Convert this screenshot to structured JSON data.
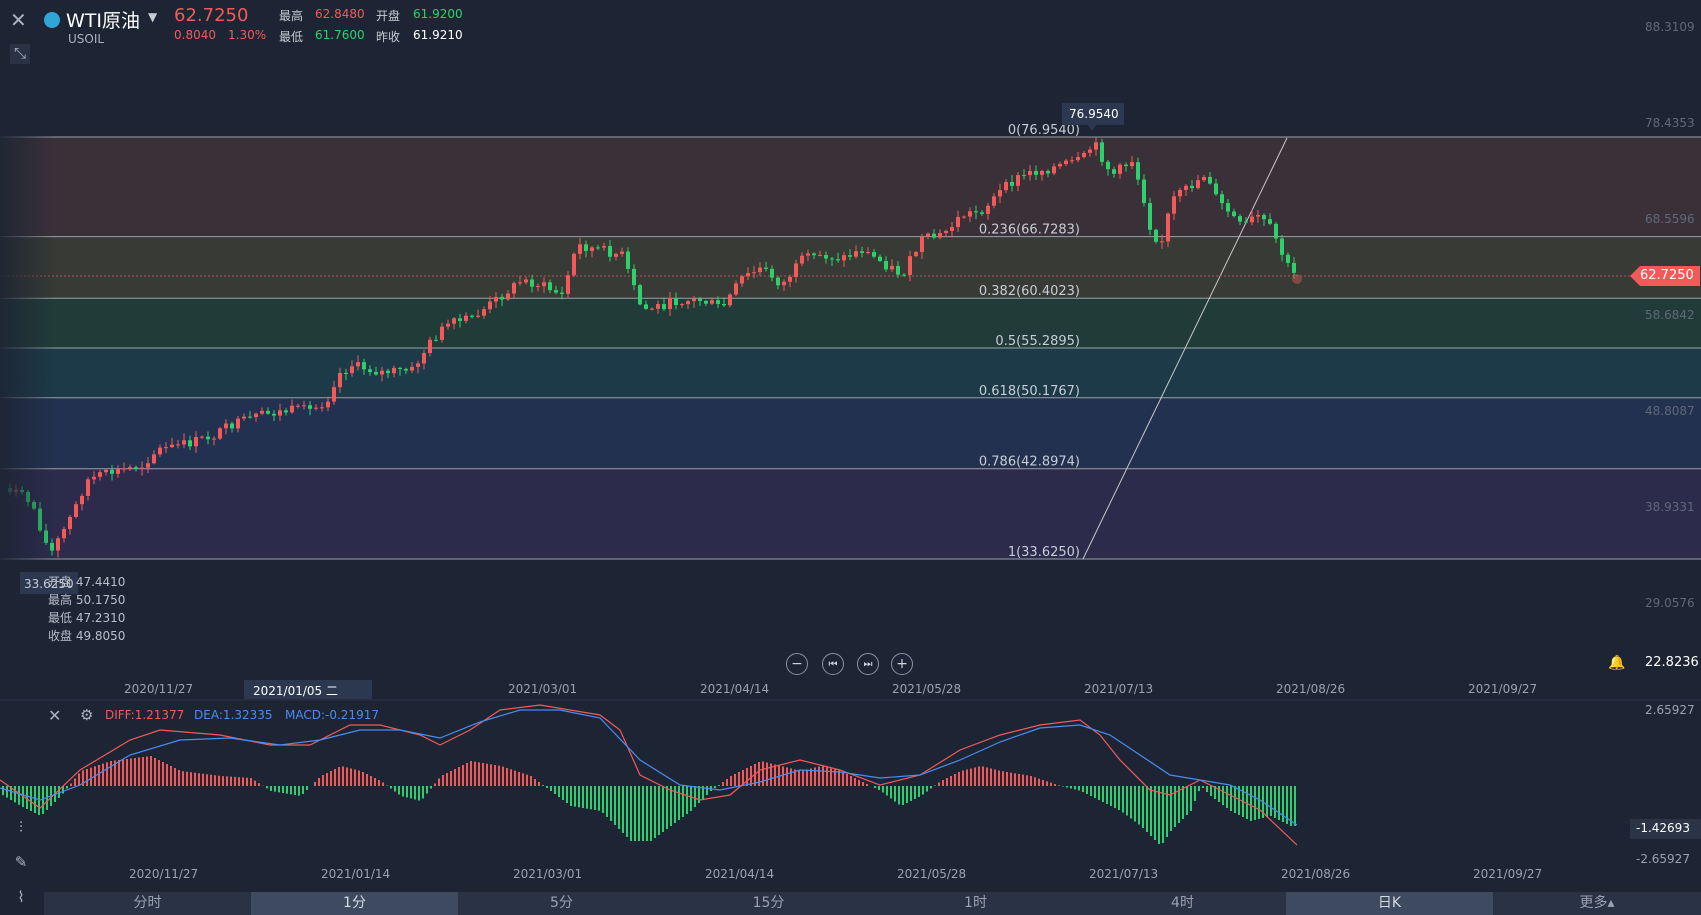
{
  "header": {
    "title": "WTI原油",
    "symbol": "USOIL",
    "price": "62.7250",
    "change": "0.8040",
    "change_pct": "1.30%",
    "high_label": "最高",
    "high": "62.8480",
    "open_label": "开盘",
    "open": "61.9200",
    "low_label": "最低",
    "low": "61.7600",
    "prev_label": "昨收",
    "prev": "61.9210"
  },
  "crosshair": {
    "price_tag": "33.6250",
    "date_tag": "2021/01/05 二",
    "open_line": "开盘 47.4410",
    "high_line": "最高 50.1750",
    "low_line": "最低 47.2310",
    "close_line": "收盘 49.8050"
  },
  "price_axis": [
    "88.3109",
    "78.4353",
    "68.5596",
    "58.6842",
    "48.8087",
    "38.9331",
    "29.0576",
    "22.8236"
  ],
  "current_price_tag": "62.7250",
  "high_tag": "76.9540",
  "date_axis": [
    "2020/11/27",
    "2021/01/14",
    "2021/03/01",
    "2021/04/14",
    "2021/05/28",
    "2021/07/13",
    "2021/08/26",
    "2021/09/27"
  ],
  "fib_levels": [
    {
      "label": "0(76.9540)",
      "value": 76.954
    },
    {
      "label": "0.236(66.7283)",
      "value": 66.7283
    },
    {
      "label": "0.382(60.4023)",
      "value": 60.4023
    },
    {
      "label": "0.5(55.2895)",
      "value": 55.2895
    },
    {
      "label": "0.618(50.1767)",
      "value": 50.1767
    },
    {
      "label": "0.786(42.8974)",
      "value": 42.8974
    },
    {
      "label": "1(33.6250)",
      "value": 33.625
    }
  ],
  "macd": {
    "diff_label": "DIFF:1.21377",
    "dea_label": "DEA:1.32335",
    "macd_label": "MACD:-0.21917",
    "axis": [
      "2.65927",
      "-1.42693",
      "-2.65927"
    ]
  },
  "tabs": [
    "分时",
    "1分",
    "5分",
    "15分",
    "1时",
    "4时",
    "日K",
    "更多▴"
  ],
  "colors": {
    "up": "#f25a5a",
    "down": "#2fd06c",
    "diff": "#f25a5a",
    "dea": "#4a8cf0"
  },
  "chart_data": {
    "type": "candlestick",
    "title": "WTI原油 USOIL 日K",
    "ylim": [
      22.8236,
      88.3109
    ],
    "key_points": [
      {
        "date": "2020/11/02",
        "value": 33.625,
        "label": "low"
      },
      {
        "date": "2021/01/05",
        "open": 47.441,
        "high": 50.175,
        "low": 47.231,
        "close": 49.805
      },
      {
        "date": "2021/03/05",
        "value": 66.5
      },
      {
        "date": "2021/03/24",
        "value": 57.5
      },
      {
        "date": "2021/06/01",
        "value": 68.0
      },
      {
        "date": "2021/07/06",
        "value": 76.954,
        "label": "high"
      },
      {
        "date": "2021/07/20",
        "value": 65.0
      },
      {
        "date": "2021/07/30",
        "value": 74.0
      },
      {
        "date": "2021/08/20",
        "value": 62.0
      },
      {
        "date": "2021/08/23",
        "value": 62.725,
        "label": "last"
      }
    ]
  }
}
